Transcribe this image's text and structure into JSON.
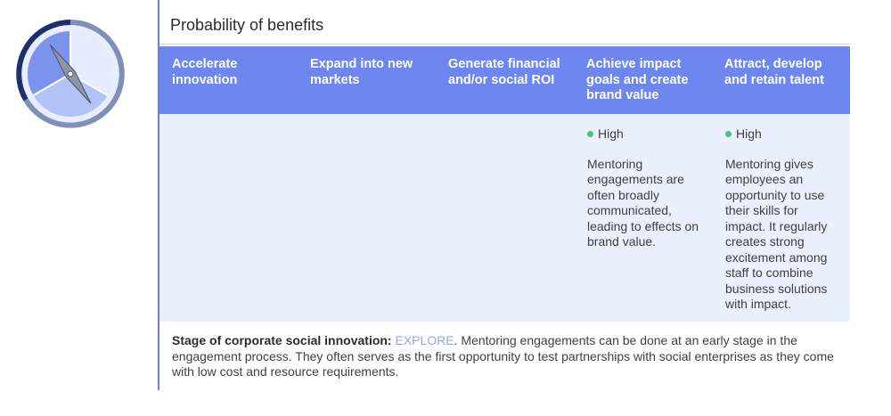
{
  "title": "Probability of benefits",
  "columns": [
    "Accelerate innovation",
    "Expand into new markets",
    "Generate financial and/or social ROI",
    "Achieve impact goals and create brand value",
    "Attract, develop and retain talent"
  ],
  "cells": [
    {
      "level": "",
      "text": ""
    },
    {
      "level": "",
      "text": ""
    },
    {
      "level": "",
      "text": ""
    },
    {
      "level": "High",
      "text": "Mentoring engagements are often broadly communicated, leading to effects on brand value."
    },
    {
      "level": "High",
      "text": "Mentoring gives employees an opportunity to use their skills for impact. It regularly creates strong excitement among staff to combine business solutions with impact."
    }
  ],
  "stage": {
    "label": "Stage of corporate social innovation:",
    "value": "EXPLORE",
    "text": ". Mentoring engagements can be done at an early stage in the engagement process. They often serves as the first opportunity to test partnerships with social enterprises as they come with low cost and resource requirements."
  },
  "icon": "compass-icon",
  "colors": {
    "accent": "#6d86f0",
    "body_bg": "#eaf0fd",
    "status_high": "#4ec27a",
    "stage_value": "#8ea8ee"
  }
}
